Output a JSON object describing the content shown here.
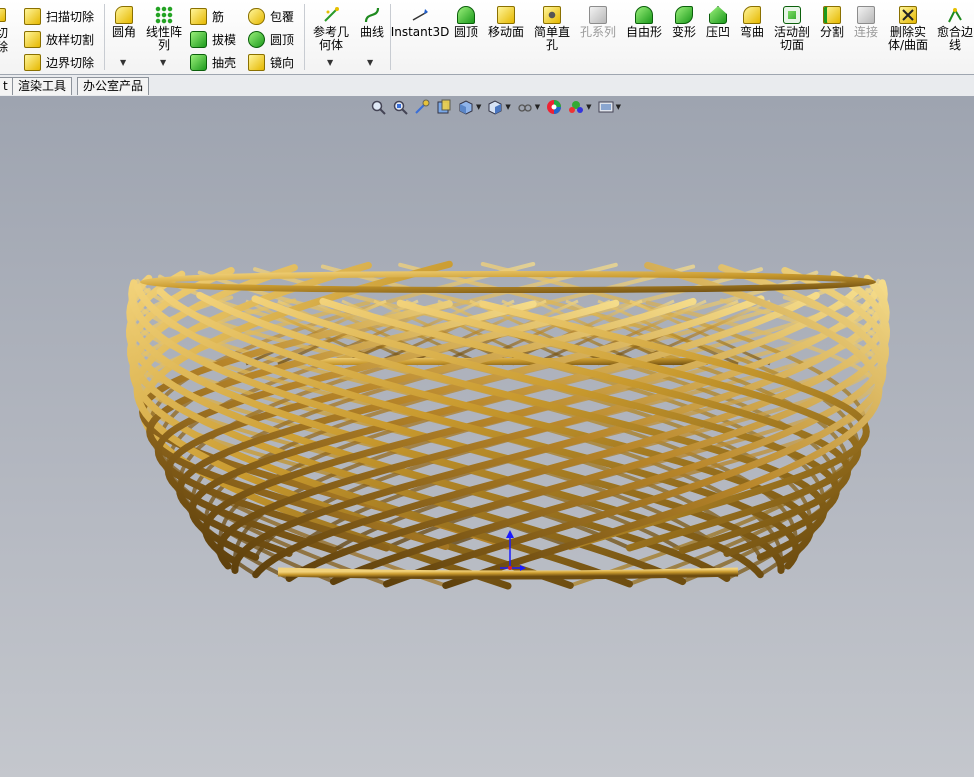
{
  "ribbon": {
    "partial_left": {
      "line1": "切",
      "line2": "除"
    },
    "col1": [
      {
        "label": "扫描切除",
        "icon": "sweep-cut-icon"
      },
      {
        "label": "放样切割",
        "icon": "loft-cut-icon"
      },
      {
        "label": "边界切除",
        "icon": "boundary-cut-icon"
      }
    ],
    "fillet": {
      "label": "圆角",
      "icon": "fillet-icon"
    },
    "linear_pattern": {
      "label": "线性阵\n列",
      "icon": "linear-pattern-icon"
    },
    "col3": [
      {
        "label": "筋",
        "icon": "rib-icon"
      },
      {
        "label": "拔模",
        "icon": "draft-icon"
      },
      {
        "label": "抽壳",
        "icon": "shell-icon"
      }
    ],
    "col4": [
      {
        "label": "包覆",
        "icon": "wrap-icon"
      },
      {
        "label": "圆顶",
        "icon": "dome-icon"
      },
      {
        "label": "镜向",
        "icon": "mirror-icon"
      }
    ],
    "ref_geometry": {
      "label": "参考几\n何体",
      "icon": "reference-geometry-icon"
    },
    "curves": {
      "label": "曲线",
      "icon": "curves-icon"
    },
    "buttons": [
      {
        "label": "Instant3D",
        "icon": "instant3d-icon",
        "enabled": true
      },
      {
        "label": "圆顶",
        "icon": "dome-icon",
        "enabled": true
      },
      {
        "label": "移动面",
        "icon": "move-face-icon",
        "enabled": true
      },
      {
        "label": "简单直\n孔",
        "icon": "simple-hole-icon",
        "enabled": true
      },
      {
        "label": "孔系列",
        "icon": "hole-series-icon",
        "enabled": false
      },
      {
        "label": "自由形",
        "icon": "freeform-icon",
        "enabled": true
      },
      {
        "label": "变形",
        "icon": "deform-icon",
        "enabled": true
      },
      {
        "label": "压凹",
        "icon": "indent-icon",
        "enabled": true
      },
      {
        "label": "弯曲",
        "icon": "flex-icon",
        "enabled": true
      },
      {
        "label": "活动剖\n切面",
        "icon": "live-section-icon",
        "enabled": true
      },
      {
        "label": "分割",
        "icon": "split-icon",
        "enabled": true
      },
      {
        "label": "连接",
        "icon": "combine-icon",
        "enabled": false
      },
      {
        "label": "删除实\n体/曲面",
        "icon": "delete-body-icon",
        "enabled": true
      },
      {
        "label": "愈合边\n线",
        "icon": "heal-edges-icon",
        "enabled": true
      }
    ]
  },
  "tabs": [
    {
      "label": "t"
    },
    {
      "label": "渲染工具"
    },
    {
      "label": "办公室产品"
    }
  ],
  "view_tools": [
    "zoom-to-fit-icon",
    "zoom-to-area-icon",
    "previous-view-icon",
    "section-view-icon",
    "view-orientation-icon",
    "display-style-icon",
    "hide-show-icon",
    "edit-appearance-icon",
    "apply-scene-icon",
    "view-settings-icon"
  ],
  "colors": {
    "gold": "#c99a2e",
    "gold_light": "#f2d27a",
    "gold_dark": "#6e4d10",
    "axis_blue": "#1a1aff"
  }
}
